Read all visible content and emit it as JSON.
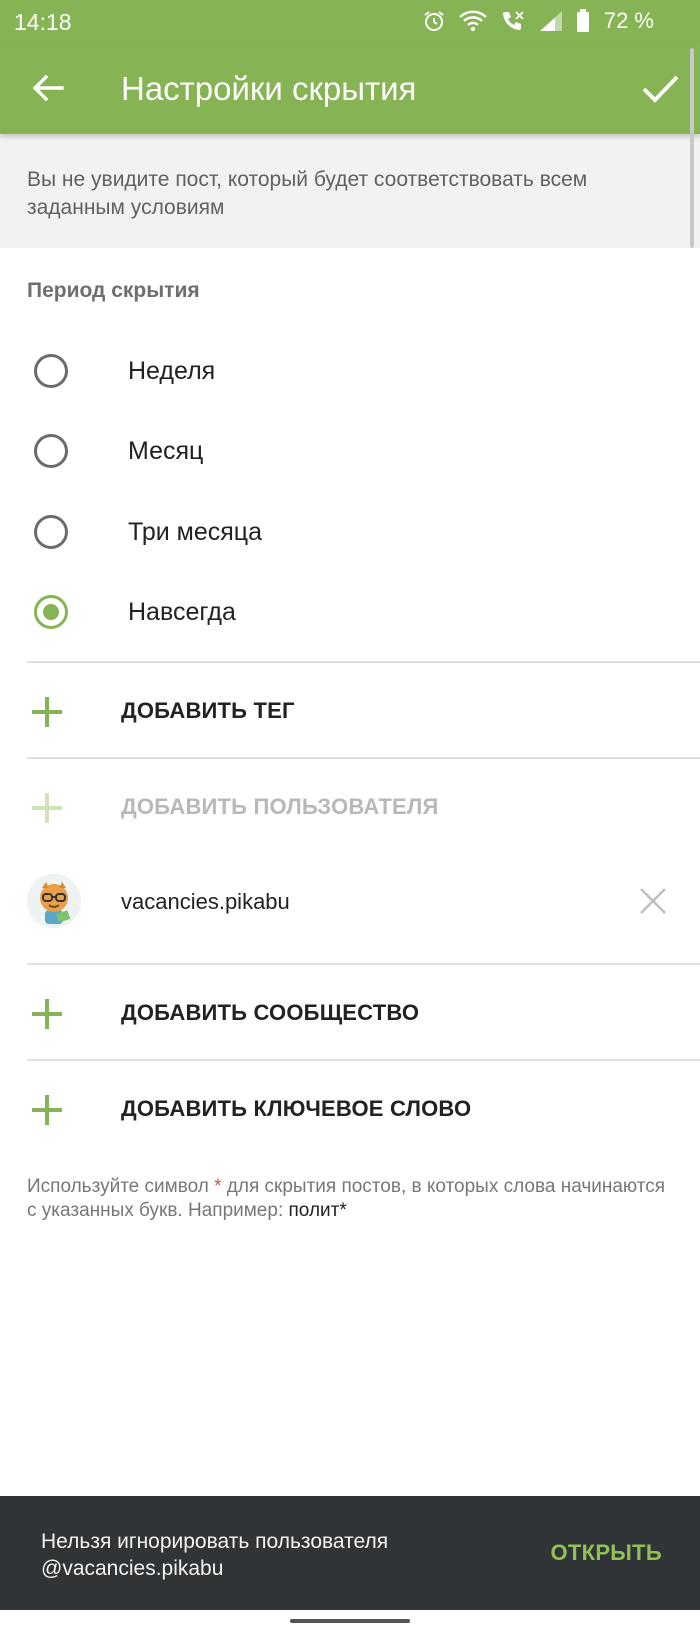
{
  "status_bar": {
    "time": "14:18",
    "battery": "72 %",
    "icons": [
      "alarm-icon",
      "wifi-icon",
      "call-icon",
      "signal-icon",
      "battery-icon"
    ]
  },
  "app_bar": {
    "title": "Настройки скрытия",
    "back_icon": "arrow-back-icon",
    "confirm_icon": "checkmark-icon"
  },
  "info": {
    "text": "Вы не увидите пост, который будет соответствовать всем заданным условиям"
  },
  "period": {
    "title": "Период скрытия",
    "options": [
      {
        "label": "Неделя",
        "checked": false
      },
      {
        "label": "Месяц",
        "checked": false
      },
      {
        "label": "Три месяца",
        "checked": false
      },
      {
        "label": "Навсегда",
        "checked": true
      }
    ]
  },
  "actions": {
    "add_tag": "ДОБАВИТЬ ТЕГ",
    "add_user": "ДОБАВИТЬ ПОЛЬЗОВАТЕЛЯ",
    "add_community": "ДОБАВИТЬ СООБЩЕСТВО",
    "add_keyword": "ДОБАВИТЬ КЛЮЧЕВОЕ СЛОВО"
  },
  "user": {
    "name": "vacancies.pikabu"
  },
  "hint": {
    "before": "Используйте символ ",
    "star": "*",
    "after": " для скрытия постов, в которых слова начинаются с указанных букв. Например: ",
    "example": "полит*"
  },
  "snackbar": {
    "message": "Нельзя игнорировать пользователя @vacancies.pikabu",
    "action": "ОТКРЫТЬ"
  },
  "colors": {
    "accent": "#86b353",
    "snackbar_bg": "#303437",
    "snackbar_action": "#8fc155"
  }
}
